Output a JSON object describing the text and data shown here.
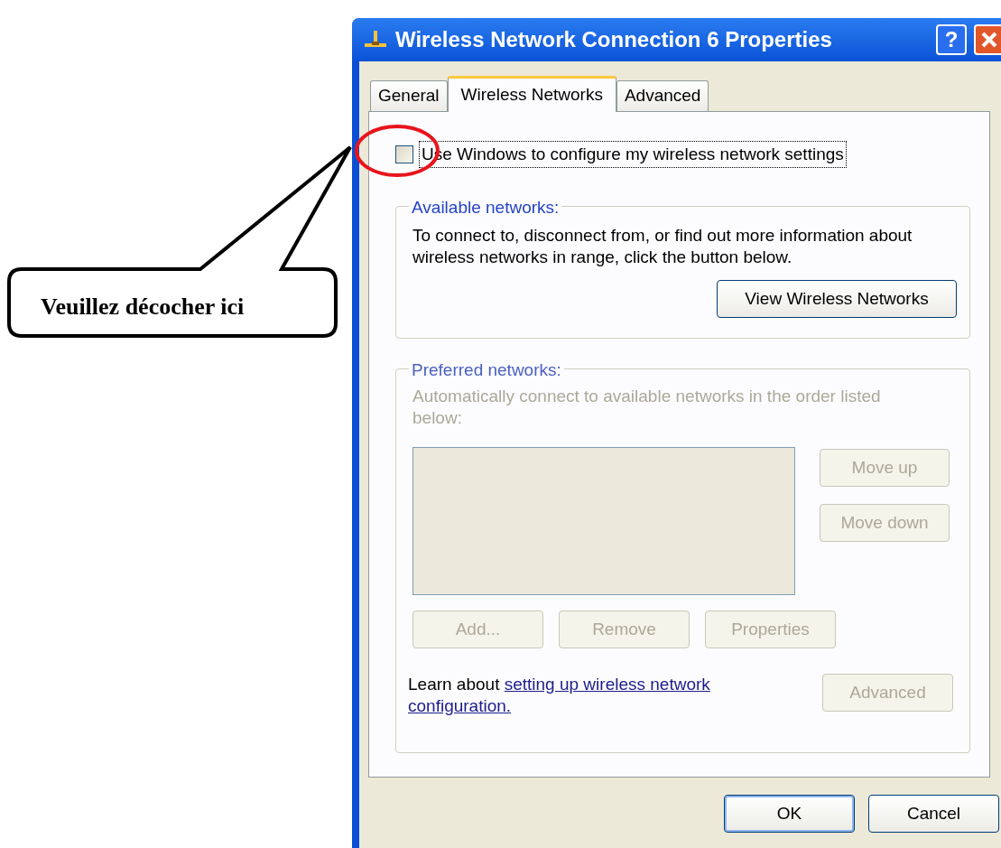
{
  "annotation": {
    "text": "Veuillez décocher ici"
  },
  "window": {
    "title": "Wireless Network Connection 6 Properties",
    "help_button": "?",
    "tabs": [
      {
        "label": "General",
        "selected": false
      },
      {
        "label": "Wireless Networks",
        "selected": true
      },
      {
        "label": "Advanced",
        "selected": false
      }
    ],
    "use_windows_checkbox": {
      "label": "Use Windows to configure my wireless network settings",
      "checked": false
    },
    "available_networks": {
      "title": "Available networks:",
      "description": "To connect to, disconnect from, or find out more information about wireless networks in range, click the button below.",
      "button": "View Wireless Networks"
    },
    "preferred_networks": {
      "title": "Preferred networks:",
      "disabled": true,
      "description": "Automatically connect to available networks in the order listed below:",
      "side_buttons": [
        {
          "label": "Move up",
          "disabled": true
        },
        {
          "label": "Move down",
          "disabled": true
        }
      ],
      "list_buttons": [
        {
          "label": "Add...",
          "disabled": true
        },
        {
          "label": "Remove",
          "disabled": true
        },
        {
          "label": "Properties",
          "disabled": true
        }
      ],
      "learn_about": {
        "text": "Learn about",
        "link": "setting up wireless network configuration."
      },
      "advanced_button": {
        "label": "Advanced",
        "disabled": true
      }
    },
    "buttons": [
      "OK",
      "Cancel"
    ]
  }
}
